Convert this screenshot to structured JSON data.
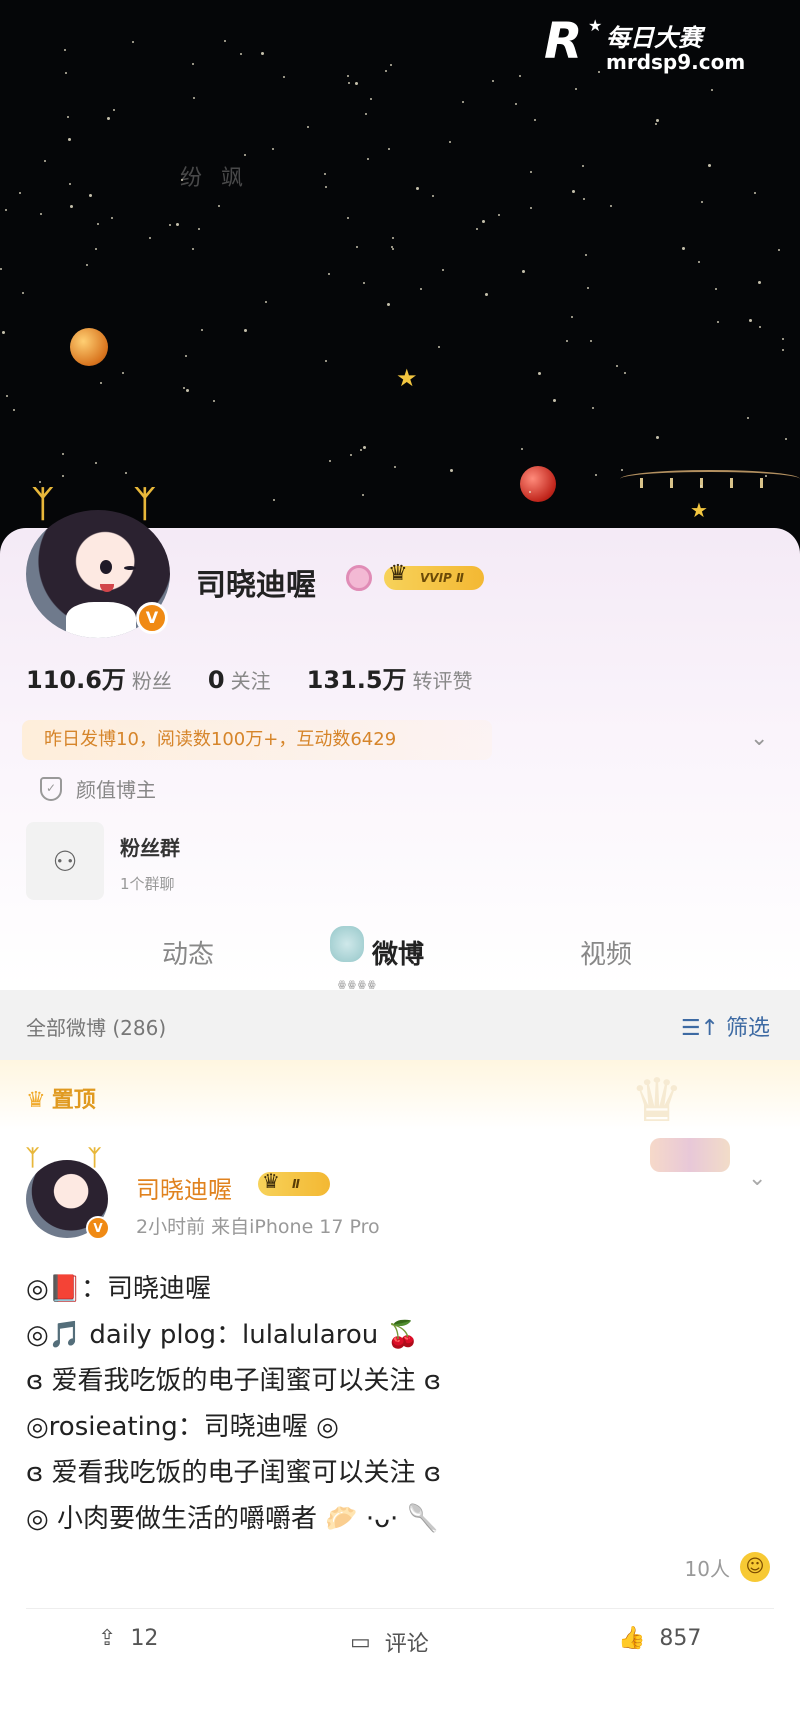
{
  "watermark": {
    "logo": "R",
    "title": "每日大赛",
    "url": "mrdsp9.com"
  },
  "banner": {
    "faint_text": "纷 飒"
  },
  "profile": {
    "name": "司晓迪喔",
    "vip_label": "VVIP Ⅱ",
    "verified_mark": "V",
    "stats": [
      {
        "value": "110.6万",
        "label": "粉丝"
      },
      {
        "value": "0",
        "label": "关注"
      },
      {
        "value": "131.5万",
        "label": "转评赞"
      }
    ],
    "summary": "昨日发博10，阅读数100万+，互动数6429",
    "tag": "颜值博主",
    "fan_group": {
      "title": "粉丝群",
      "subtitle": "1个群聊"
    }
  },
  "tabs": [
    {
      "label": "动态",
      "active": false
    },
    {
      "label": "微博",
      "active": true
    },
    {
      "label": "视频",
      "active": false
    }
  ],
  "filter": {
    "label": "全部微博 (286)",
    "button": "筛选"
  },
  "pinned": {
    "label": "置顶"
  },
  "post": {
    "author": "司晓迪喔",
    "vip_label": "Ⅱ",
    "meta": "2小时前  来自iPhone 17 Pro",
    "lines": [
      "◎📕：司晓迪喔",
      "◎🎵 daily plog：lulalularou 🍒",
      "ɞ 爱看我吃饭的电子闺蜜可以关注 ɞ",
      "◎rosieating：司晓迪喔 ◎",
      "ɞ 爱看我吃饭的电子闺蜜可以关注 ɞ",
      "◎ 小肉要做生活的嚼嚼者 🥟 ·ᴗ· 🥄"
    ],
    "likers": "10人",
    "actions": [
      {
        "icon": "repost-icon",
        "glyph": "⇪",
        "count": "12"
      },
      {
        "icon": "comment-icon",
        "glyph": "▭",
        "count": "评论"
      },
      {
        "icon": "like-icon",
        "glyph": "👍",
        "count": "857"
      }
    ]
  },
  "colors": {
    "accent": "#f08a14",
    "link": "#3d6aa3",
    "summary": "#d6852a"
  }
}
